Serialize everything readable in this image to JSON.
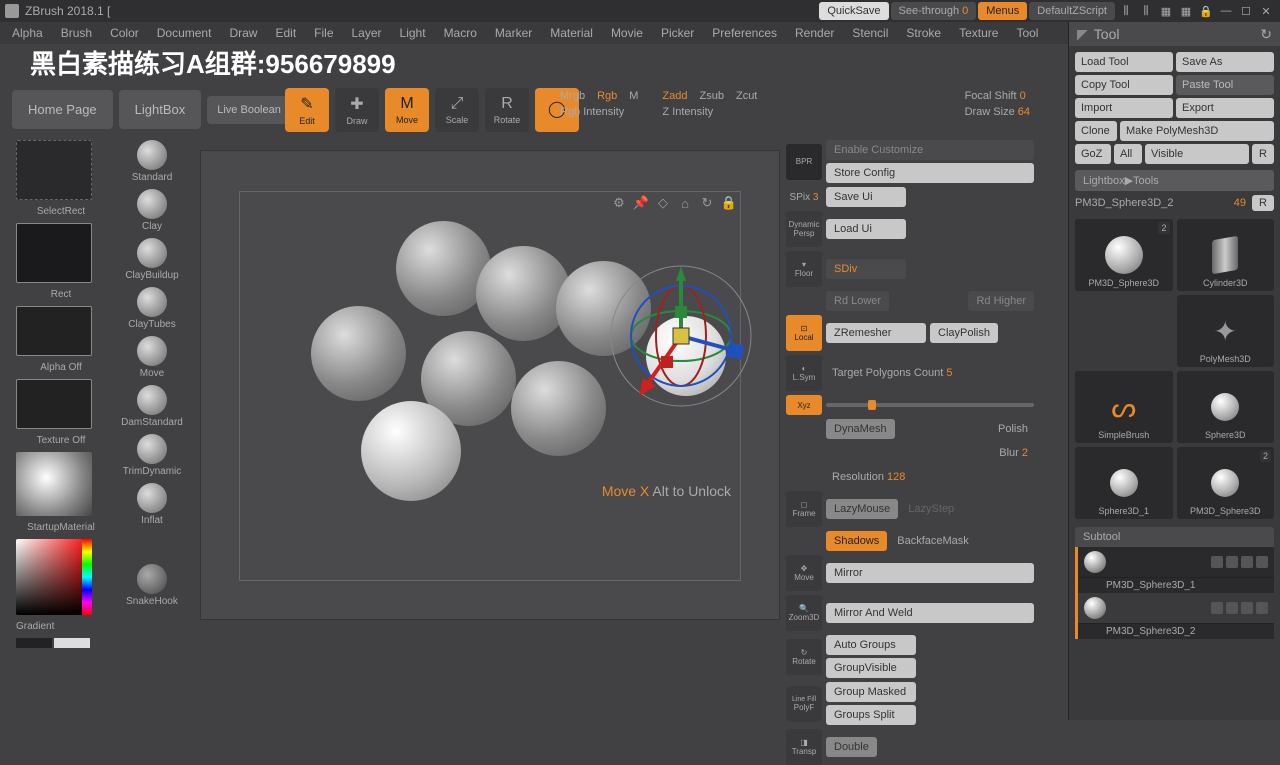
{
  "app": {
    "title": "ZBrush 2018.1 ["
  },
  "topButtons": {
    "quicksave": "QuickSave",
    "seeThrough": "See-through",
    "seeThroughVal": "0",
    "menus": "Menus",
    "defaultScript": "DefaultZScript"
  },
  "menu": [
    "Alpha",
    "Brush",
    "Color",
    "Document",
    "Draw",
    "Edit",
    "File",
    "Layer",
    "Light",
    "Macro",
    "Marker",
    "Material",
    "Movie",
    "Picker",
    "Preferences",
    "Render",
    "Stencil",
    "Stroke",
    "Texture",
    "Tool"
  ],
  "overlay": "黑白素描练习A组群:956679899",
  "toolbar": {
    "home": "Home Page",
    "lightbox": "LightBox",
    "liveBool": "Live Boolean"
  },
  "gizmos": [
    {
      "label": "Edit",
      "icon": "✎",
      "active": true
    },
    {
      "label": "Draw",
      "icon": "✚",
      "active": false
    },
    {
      "label": "Move",
      "icon": "M",
      "active": true
    },
    {
      "label": "Scale",
      "icon": "⤢",
      "active": false
    },
    {
      "label": "Rotate",
      "icon": "R",
      "active": false
    },
    {
      "label": "",
      "icon": "◯",
      "active": true
    }
  ],
  "topSliders": {
    "mrgb": "Mrgb",
    "rgb": "Rgb",
    "m": "M",
    "zadd": "Zadd",
    "zsub": "Zsub",
    "zcut": "Zcut",
    "rgbInt": "Rgb Intensity",
    "zInt": "Z Intensity",
    "focalShift": "Focal Shift",
    "focalShiftVal": "0",
    "drawSize": "Draw Size",
    "drawSizeVal": "64"
  },
  "leftCol": {
    "selectRect": "SelectRect",
    "rect": "Rect",
    "alphaOff": "Alpha Off",
    "textureOff": "Texture Off",
    "startupMat": "StartupMaterial",
    "gradient": "Gradient"
  },
  "brushes": [
    "Standard",
    "Clay",
    "ClayBuildup",
    "ClayTubes",
    "Move",
    "DamStandard",
    "TrimDynamic",
    "Inflat",
    "",
    "SnakeHook"
  ],
  "canvas": {
    "statusMove": "Move X",
    "statusAlt": "Alt to Unlock"
  },
  "viewIcons": [
    "gear-icon",
    "pin-icon",
    "marker-icon",
    "home-icon",
    "refresh-icon",
    "lock-icon"
  ],
  "midPanel": {
    "spix": "SPix",
    "spixVal": "3",
    "enableCustomize": "Enable Customize",
    "storeConfig": "Store Config",
    "saveUi": "Save Ui",
    "loadUi": "Load Ui",
    "dynamic": "Dynamic",
    "persp": "Persp",
    "sdiv": "SDiv",
    "floor": "Floor",
    "rdlower": "Rd Lower",
    "rdhigher": "Rd Higher",
    "local": "Local",
    "zremesher": "ZRemesher",
    "claypolish": "ClayPolish",
    "lsym": "L.Sym",
    "targetPoly": "Target Polygons Count",
    "targetPolyVal": "5",
    "xyz": "Xyz",
    "dynamesh": "DynaMesh",
    "polish": "Polish",
    "blur": "Blur",
    "blurVal": "2",
    "resolution": "Resolution",
    "resolutionVal": "128",
    "frame": "Frame",
    "lazymouse": "LazyMouse",
    "lazystep": "LazyStep",
    "shadows": "Shadows",
    "backface": "BackfaceMask",
    "move": "Move",
    "mirror": "Mirror",
    "mirrorWeld": "Mirror And Weld",
    "zoom": "Zoom3D",
    "autogroups": "Auto Groups",
    "groupvisible": "GroupVisible",
    "rotate": "Rotate",
    "groupmasked": "Group Masked",
    "groupssplit": "Groups Split",
    "linefill": "Line Fill",
    "polyf": "PolyF",
    "transp": "Transp",
    "double": "Double"
  },
  "rightPanel": {
    "header": "Tool",
    "actions": {
      "loadTool": "Load Tool",
      "saveAs": "Save As",
      "copyTool": "Copy Tool",
      "pasteTool": "Paste Tool",
      "import": "Import",
      "export": "Export",
      "clone": "Clone",
      "makePoly": "Make PolyMesh3D",
      "goz": "GoZ",
      "all": "All",
      "visible": "Visible",
      "r": "R"
    },
    "lightbox": "Lightbox▶Tools",
    "toolName": "PM3D_Sphere3D_2",
    "toolNum": "49",
    "tools": [
      {
        "label": "PM3D_Sphere3D",
        "type": "sphere",
        "badge": "2"
      },
      {
        "label": "Cylinder3D",
        "type": "cyl",
        "badge": ""
      },
      {
        "label": "",
        "type": "none",
        "badge": ""
      },
      {
        "label": "PolyMesh3D",
        "type": "star",
        "badge": ""
      },
      {
        "label": "SimpleBrush",
        "type": "brush",
        "badge": ""
      },
      {
        "label": "Sphere3D",
        "type": "sphere",
        "badge": ""
      },
      {
        "label": "Sphere3D_1",
        "type": "sphere",
        "badge": ""
      },
      {
        "label": "PM3D_Sphere3D",
        "type": "sphere",
        "badge": "2"
      }
    ],
    "subtool": "Subtool",
    "subtools": [
      {
        "label": "PM3D_Sphere3D_1",
        "sel": false
      },
      {
        "label": "PM3D_Sphere3D_2",
        "sel": true
      }
    ]
  }
}
